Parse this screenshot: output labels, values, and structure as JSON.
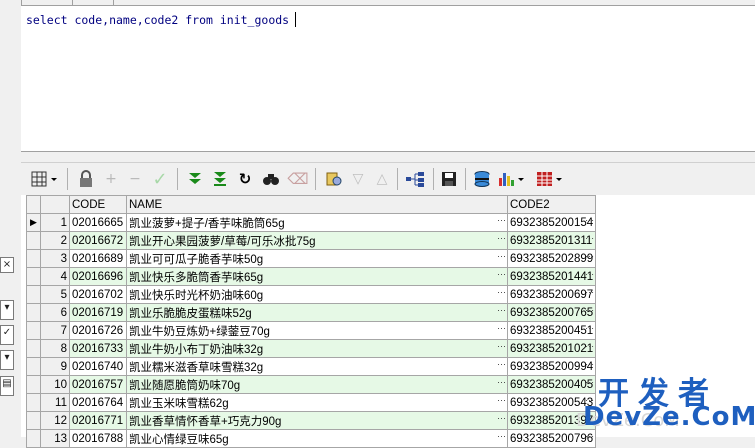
{
  "editor": {
    "sql": "select code,name,code2 from init_goods"
  },
  "left_strip": {
    "close_glyph": "×",
    "combo_glyph": "✓"
  },
  "toolbar": {
    "icons": [
      "grid-menu-icon",
      "lock-icon",
      "add-record-icon",
      "delete-record-icon",
      "post-check-icon",
      "fetch-next-icon",
      "fetch-all-icon",
      "refresh-icon",
      "find-icon",
      "clear-icon",
      "query-by-example-icon",
      "sort-desc-icon",
      "sort-asc-icon",
      "tree-icon",
      "save-icon",
      "export-icon",
      "chart-icon",
      "table-icon"
    ]
  },
  "grid": {
    "columns": [
      "CODE",
      "NAME",
      "CODE2"
    ],
    "rows": [
      {
        "n": "1",
        "code": "02016665",
        "name": "凯业菠萝+提子/香芋味脆筒65g",
        "code2": "6932385200154"
      },
      {
        "n": "2",
        "code": "02016672",
        "name": "凯业开心果园菠萝/草莓/可乐冰批75g",
        "code2": "6932385201311"
      },
      {
        "n": "3",
        "code": "02016689",
        "name": "凯业可可瓜子脆香芋味50g",
        "code2": "6932385202899"
      },
      {
        "n": "4",
        "code": "02016696",
        "name": "凯业快乐多脆筒香芋味65g",
        "code2": "6932385201441"
      },
      {
        "n": "5",
        "code": "02016702",
        "name": "凯业快乐时光杯奶油味60g",
        "code2": "6932385200697"
      },
      {
        "n": "6",
        "code": "02016719",
        "name": "凯业乐脆脆皮蛋糕味52g",
        "code2": "6932385200765"
      },
      {
        "n": "7",
        "code": "02016726",
        "name": "凯业牛奶豆炼奶+绿蓥豆70g",
        "code2": "6932385200451"
      },
      {
        "n": "8",
        "code": "02016733",
        "name": "凯业牛奶小布丁奶油味32g",
        "code2": "6932385201021"
      },
      {
        "n": "9",
        "code": "02016740",
        "name": "凯业糯米滋香草味雪糕32g",
        "code2": "6932385200994"
      },
      {
        "n": "10",
        "code": "02016757",
        "name": "凯业随愿脆筒奶味70g",
        "code2": "6932385200405"
      },
      {
        "n": "11",
        "code": "02016764",
        "name": "凯业玉米味雪糕62g",
        "code2": "6932385200543"
      },
      {
        "n": "12",
        "code": "02016771",
        "name": "凯业香草情怀香草+巧克力90g",
        "code2": "6932385201397"
      },
      {
        "n": "13",
        "code": "02016788",
        "name": "凯业心情绿豆味65g",
        "code2": "6932385200796"
      }
    ]
  },
  "watermark": {
    "line1": "开发者",
    "line2": "DevZe.CoM"
  }
}
